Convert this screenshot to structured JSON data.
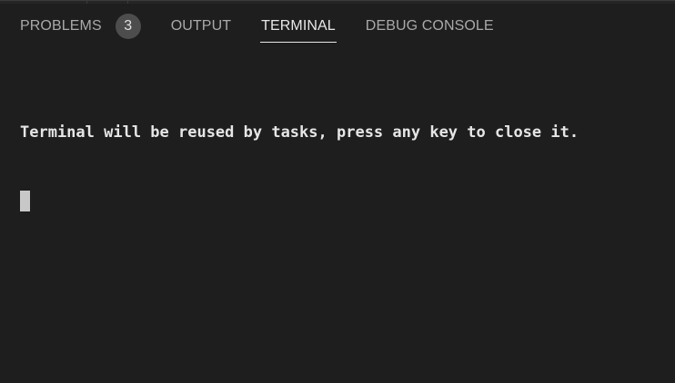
{
  "panel": {
    "tabs": [
      {
        "label": "PROBLEMS",
        "badge": "3",
        "active": false
      },
      {
        "label": "OUTPUT",
        "active": false
      },
      {
        "label": "TERMINAL",
        "active": true
      },
      {
        "label": "DEBUG CONSOLE",
        "active": false
      }
    ]
  },
  "terminal": {
    "lines": [
      "Terminal will be reused by tasks, press any key to close it."
    ]
  },
  "colors": {
    "background": "#1e1e1e",
    "tab_inactive": "#a9a9a9",
    "tab_active": "#e7e7e7",
    "badge_bg": "#4d4d4d",
    "terminal_text": "#e6e6e6",
    "cursor": "#c8c8c8"
  }
}
